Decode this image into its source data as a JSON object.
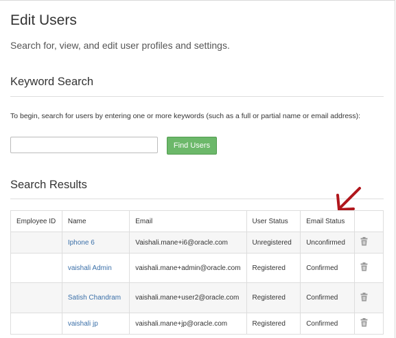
{
  "header": {
    "title": "Edit Users",
    "subtitle": "Search for, view, and edit user profiles and settings."
  },
  "keyword_search": {
    "title": "Keyword Search",
    "instructions": "To begin, search for users by entering one or more keywords (such as a full or partial name or email address):",
    "input_value": "",
    "input_placeholder": "",
    "button_label": "Find Users"
  },
  "results": {
    "title": "Search Results",
    "columns": [
      "Employee ID",
      "Name",
      "Email",
      "User Status",
      "Email Status",
      ""
    ],
    "rows": [
      {
        "employee_id": "",
        "name": "Iphone 6",
        "email": "Vaishali.mane+i6@oracle.com",
        "user_status": "Unregistered",
        "email_status": "Unconfirmed",
        "delete_icon": "trash-icon"
      },
      {
        "employee_id": "",
        "name": "vaishali Admin",
        "email": "vaishali.mane+admin@oracle.com",
        "user_status": "Registered",
        "email_status": "Confirmed",
        "delete_icon": "trash-icon"
      },
      {
        "employee_id": "",
        "name": "Satish Chandram",
        "email": "vaishali.mane+user2@oracle.com",
        "user_status": "Registered",
        "email_status": "Confirmed",
        "delete_icon": "trash-icon"
      },
      {
        "employee_id": "",
        "name": "vaishali jp",
        "email": "vaishali.mane+jp@oracle.com",
        "user_status": "Registered",
        "email_status": "Confirmed",
        "delete_icon": "trash-icon"
      }
    ]
  },
  "annotation": {
    "icon": "red-arrow-icon",
    "color": "#b0161c"
  },
  "colors": {
    "button": "#6cb86a",
    "link": "#3a6fa8",
    "row_alt": "#f6f6f6"
  }
}
